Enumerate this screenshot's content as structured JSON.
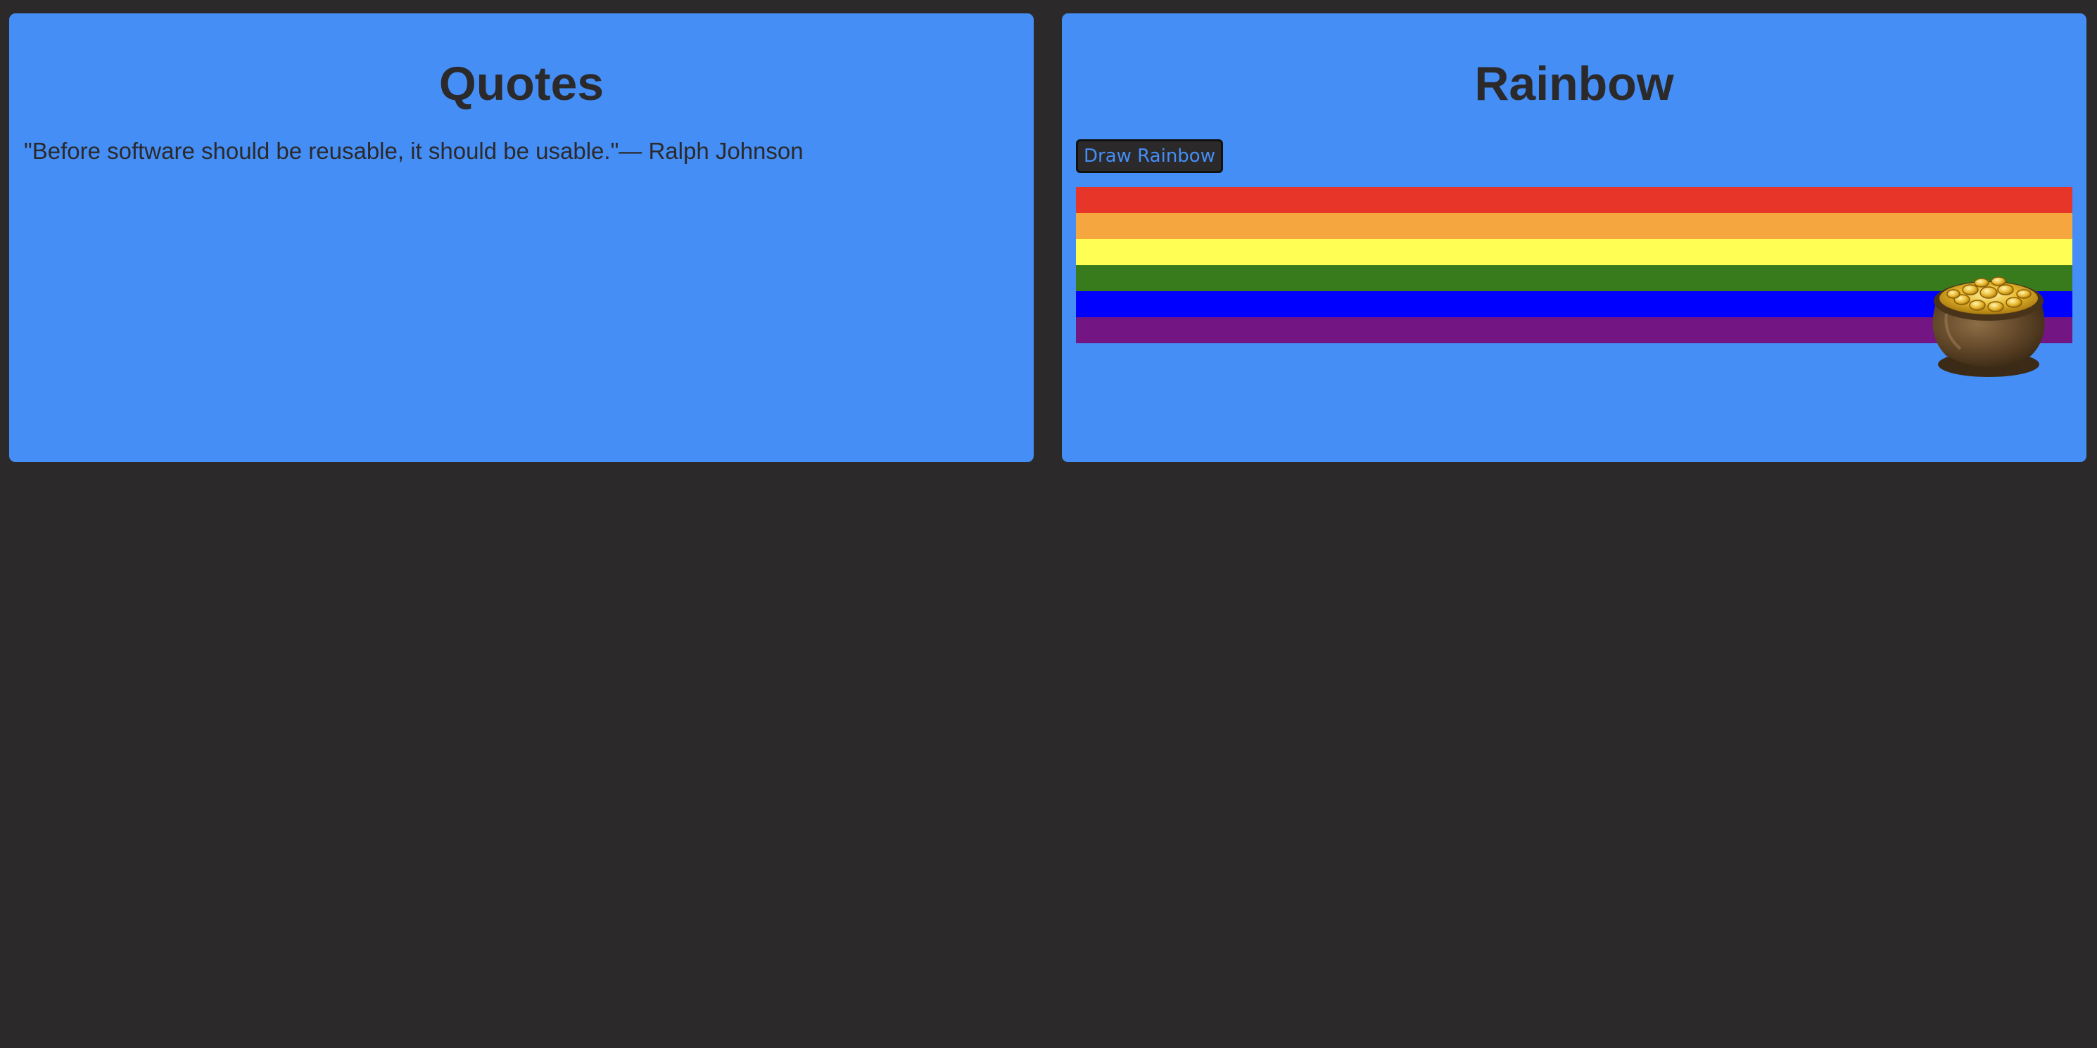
{
  "quotes_card": {
    "title": "Quotes",
    "quote": "\"Before software should be reusable, it should be usable.\"— Ralph Johnson"
  },
  "rainbow_card": {
    "title": "Rainbow",
    "button_label": "Draw Rainbow",
    "stripe_colors": [
      "#e8352a",
      "#f5a63f",
      "#fffe55",
      "#387b1c",
      "#0000ff",
      "#731582"
    ],
    "pot_icon": "pot-of-gold-icon"
  },
  "colors": {
    "background": "#2b292a",
    "card": "#448ef6",
    "text": "#2b292a"
  }
}
